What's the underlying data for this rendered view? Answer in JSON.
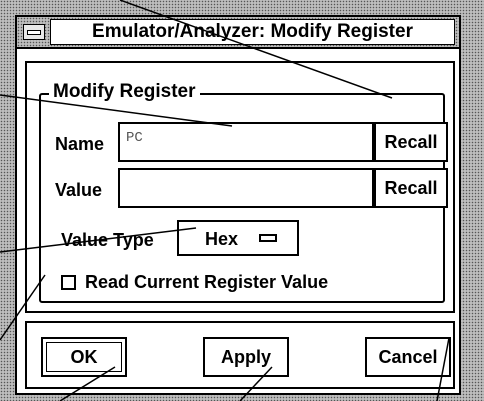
{
  "window": {
    "title": "Emulator/Analyzer: Modify Register"
  },
  "group": {
    "title": "Modify Register"
  },
  "name_row": {
    "label": "Name",
    "value": "PC",
    "recall_label": "Recall"
  },
  "value_row": {
    "label": "Value",
    "value": "",
    "recall_label": "Recall"
  },
  "value_type": {
    "label": "Value Type",
    "selected": "Hex"
  },
  "read_current": {
    "label": "Read Current Register Value",
    "checked": false
  },
  "buttons": {
    "ok": "OK",
    "apply": "Apply",
    "cancel": "Cancel"
  },
  "icons": {
    "window_menu": "window-menu-icon",
    "option_indicator": "option-menu-indicator-icon",
    "checkbox": "checkbox-icon"
  }
}
